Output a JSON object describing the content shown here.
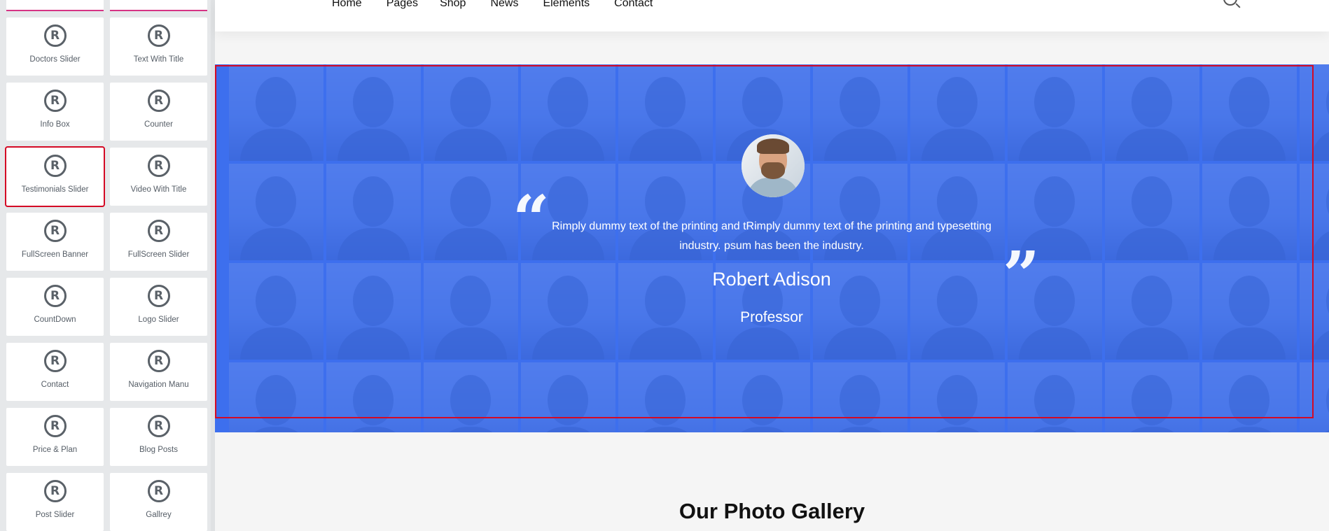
{
  "sidebar": {
    "widgets": [
      {
        "label": "Doctors Slider",
        "icon": "registered-icon"
      },
      {
        "label": "Text With Title",
        "icon": "registered-icon"
      },
      {
        "label": "Info Box",
        "icon": "registered-icon"
      },
      {
        "label": "Counter",
        "icon": "registered-icon"
      },
      {
        "label": "Testimonials Slider",
        "icon": "registered-icon",
        "selected": true
      },
      {
        "label": "Video With Title",
        "icon": "registered-icon"
      },
      {
        "label": "FullScreen Banner",
        "icon": "registered-icon"
      },
      {
        "label": "FullScreen Slider",
        "icon": "registered-icon"
      },
      {
        "label": "CountDown",
        "icon": "registered-icon"
      },
      {
        "label": "Logo Slider",
        "icon": "registered-icon"
      },
      {
        "label": "Contact",
        "icon": "registered-icon"
      },
      {
        "label": "Navigation Manu",
        "icon": "registered-icon"
      },
      {
        "label": "Price & Plan",
        "icon": "registered-icon"
      },
      {
        "label": "Blog Posts",
        "icon": "registered-icon"
      },
      {
        "label": "Post Slider",
        "icon": "registered-icon"
      },
      {
        "label": "Gallrey",
        "icon": "registered-icon"
      }
    ],
    "registered_glyph": "R"
  },
  "header": {
    "nav": [
      "Home",
      "Pages",
      "Shop",
      "News",
      "Elements",
      "Contact"
    ]
  },
  "testimonial": {
    "quote": "Rimply dummy text of the printing and tRimply dummy text of the printing and typesetting industry. psum has been the industry.",
    "name": "Robert Adison",
    "role": "Professor",
    "quote_open_glyph": "“",
    "quote_close_glyph": "”",
    "background_color": "#3d6fee"
  },
  "gallery": {
    "title": "Our Photo Gallery"
  },
  "colors": {
    "selection_outline": "#d40a25",
    "accent": "#3d6fee"
  }
}
